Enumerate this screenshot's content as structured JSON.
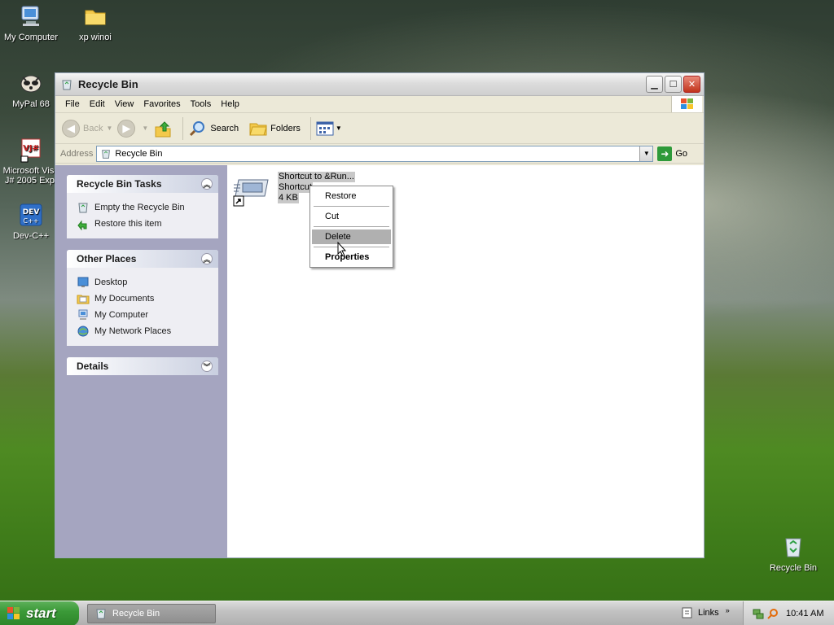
{
  "desktop": {
    "icons": [
      {
        "label": "My Computer",
        "icon": "my-computer-icon"
      },
      {
        "label": "xp winoi",
        "icon": "folder-icon"
      },
      {
        "label": "MyPal 68",
        "icon": "mypal-icon"
      },
      {
        "label_line1": "Microsoft Visu",
        "label_line2": "J# 2005 Exp.",
        "icon": "visual-j-sharp-icon"
      },
      {
        "label": "Dev-C++",
        "icon": "dev-cpp-icon"
      },
      {
        "label": "Recycle Bin",
        "icon": "recycle-bin-icon"
      }
    ]
  },
  "window": {
    "title": "Recycle Bin",
    "menu": [
      "File",
      "Edit",
      "View",
      "Favorites",
      "Tools",
      "Help"
    ],
    "toolbar": {
      "back": "Back",
      "search": "Search",
      "folders": "Folders"
    },
    "address": {
      "label": "Address",
      "value": "Recycle Bin",
      "go": "Go"
    }
  },
  "tasks_panel": {
    "title": "Recycle Bin Tasks",
    "items": [
      "Empty the Recycle Bin",
      "Restore this item"
    ]
  },
  "places_panel": {
    "title": "Other Places",
    "items": [
      "Desktop",
      "My Documents",
      "My Computer",
      "My Network Places"
    ]
  },
  "details_panel": {
    "title": "Details"
  },
  "file_item": {
    "name": "Shortcut to &Run...",
    "type": "Shortcut",
    "size": "4 KB"
  },
  "context_menu": {
    "items": [
      "Restore",
      "Cut",
      "Delete",
      "Properties"
    ],
    "selected": "Delete"
  },
  "taskbar": {
    "start": "start",
    "task": "Recycle Bin",
    "links": "Links",
    "clock": "10:41 AM"
  },
  "colors": {
    "start_green": "#3b9a38",
    "selection_gray": "#b0b0b0"
  }
}
